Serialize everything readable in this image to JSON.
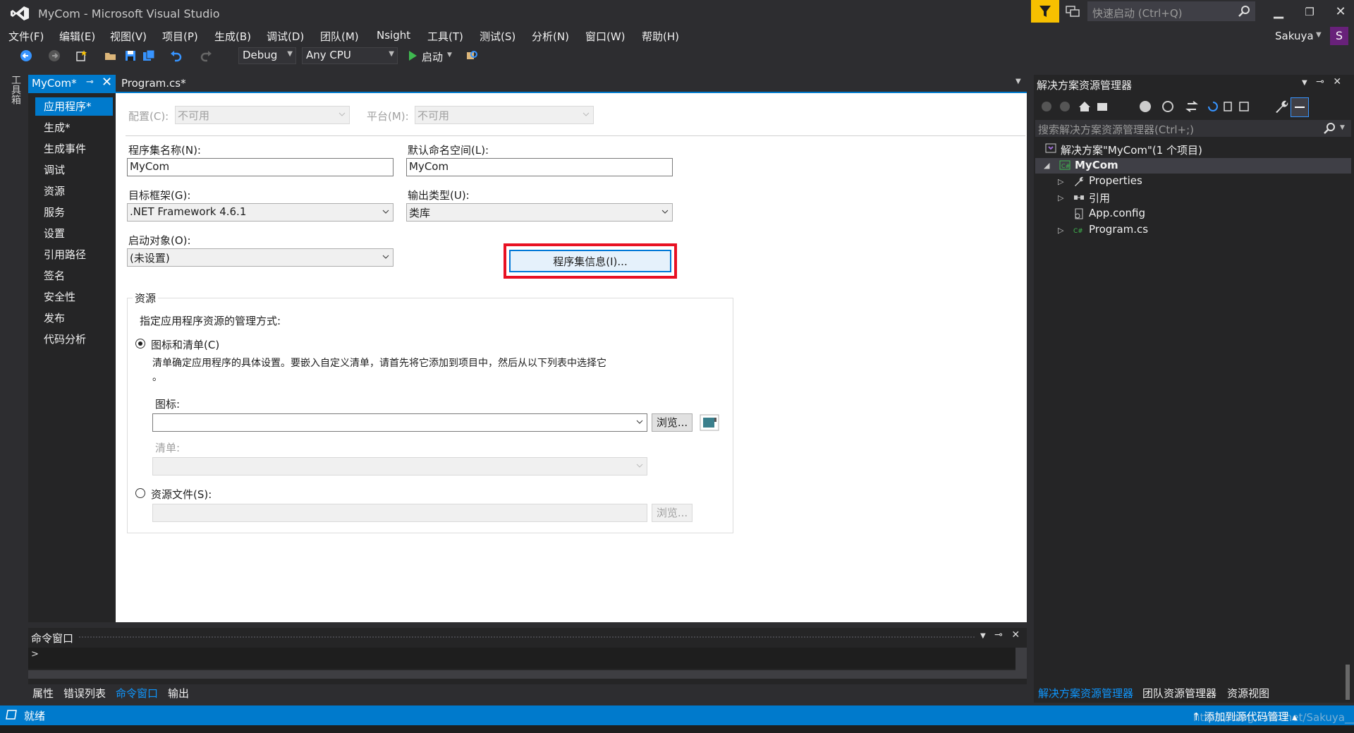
{
  "window": {
    "title": "MyCom - Microsoft Visual Studio",
    "quick_launch_placeholder": "快速启动 (Ctrl+Q)",
    "user": "Sakuya",
    "avatar_letter": "S"
  },
  "menu": [
    "文件(F)",
    "编辑(E)",
    "视图(V)",
    "项目(P)",
    "生成(B)",
    "调试(D)",
    "团队(M)",
    "Nsight",
    "工具(T)",
    "测试(S)",
    "分析(N)",
    "窗口(W)",
    "帮助(H)"
  ],
  "toolbar": {
    "config": "Debug",
    "platform": "Any CPU",
    "start_label": "启动"
  },
  "toolbox_label": "工具箱",
  "tabs": {
    "active": "MyCom*",
    "other": "Program.cs*"
  },
  "prop_nav": [
    "应用程序*",
    "生成*",
    "生成事件",
    "调试",
    "资源",
    "服务",
    "设置",
    "引用路径",
    "签名",
    "安全性",
    "发布",
    "代码分析"
  ],
  "config_row": {
    "config_label": "配置(C):",
    "config_value": "不可用",
    "platform_label": "平台(M):",
    "platform_value": "不可用"
  },
  "form": {
    "assembly_name_label": "程序集名称(N):",
    "assembly_name": "MyCom",
    "default_ns_label": "默认命名空间(L):",
    "default_ns": "MyCom",
    "target_fw_label": "目标框架(G):",
    "target_fw": ".NET Framework 4.6.1",
    "output_type_label": "输出类型(U):",
    "output_type": "类库",
    "startup_obj_label": "启动对象(O):",
    "startup_obj": "(未设置)",
    "assembly_info_button": "程序集信息(I)..."
  },
  "resources": {
    "group_title": "资源",
    "desc": "指定应用程序资源的管理方式:",
    "icon_manifest_label": "图标和清单(C)",
    "icon_manifest_desc": "清单确定应用程序的具体设置。要嵌入自定义清单，请首先将它添加到项目中，然后从以下列表中选择它",
    "icon_manifest_desc2": "。",
    "icon_label": "图标:",
    "browse": "浏览...",
    "manifest_label": "清单:",
    "resource_file_label": "资源文件(S):",
    "browse2": "浏览..."
  },
  "solution_explorer": {
    "title": "解决方案资源管理器",
    "search_placeholder": "搜索解决方案资源管理器(Ctrl+;)",
    "solution": "解决方案\"MyCom\"(1 个项目)",
    "project": "MyCom",
    "items": [
      "Properties",
      "引用",
      "App.config",
      "Program.cs"
    ]
  },
  "command_window": {
    "title": "命令窗口",
    "prompt": ">"
  },
  "bottom_tabs_left": [
    "属性",
    "错误列表",
    "命令窗口",
    "输出"
  ],
  "bottom_tabs_right": [
    "解决方案资源管理器",
    "团队资源管理器",
    "资源视图"
  ],
  "status": {
    "text": "就绪",
    "right": "↑ 添加到源代码管理 ▴"
  },
  "watermark": "https://blog.csdn.net/Sakuya__",
  "colors": {
    "accent": "#007acc",
    "highlight_box": "#e81123",
    "filter_button": "#f7c000"
  }
}
